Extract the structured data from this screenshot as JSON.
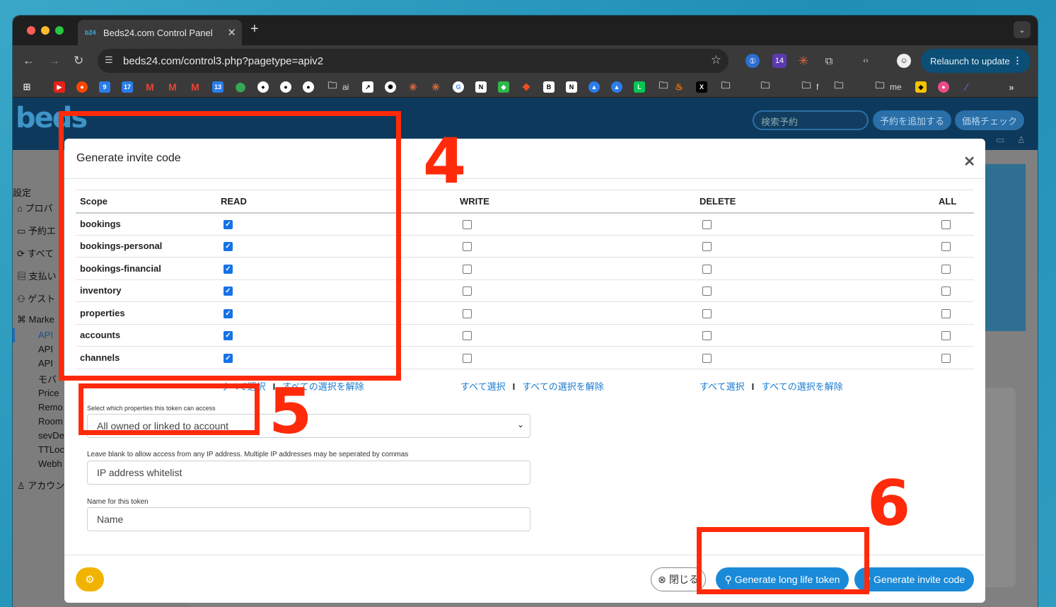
{
  "browser": {
    "tab_title": "Beds24.com Control Panel",
    "tab_favicon": "b24",
    "address": "beds24.com/control3.php?pagetype=apiv2",
    "relaunch_label": "Relaunch to update",
    "extension_badge": "14",
    "bookmark_texts": [
      "ai",
      "f",
      "me"
    ]
  },
  "app": {
    "logo_text": "beds",
    "search_placeholder": "検索予約",
    "header_buttons": [
      "予約を追加する",
      "価格チェック"
    ],
    "sidebar": {
      "section": "設定",
      "items": [
        "プロパ",
        "予約エ",
        "すべて",
        "支払い",
        "ゲスト",
        "Marke"
      ],
      "subitems": [
        "API",
        "API",
        "API",
        "モバ",
        "Price",
        "Remo",
        "Room",
        "sevDe",
        "TTLoc",
        "Webh"
      ],
      "account": "アカウン"
    }
  },
  "modal": {
    "title": "Generate invite code",
    "columns": [
      "Scope",
      "READ",
      "WRITE",
      "DELETE",
      "ALL"
    ],
    "rows": [
      {
        "scope": "bookings",
        "read": true,
        "write": false,
        "delete": false,
        "all": false
      },
      {
        "scope": "bookings-personal",
        "read": true,
        "write": false,
        "delete": false,
        "all": false
      },
      {
        "scope": "bookings-financial",
        "read": true,
        "write": false,
        "delete": false,
        "all": false
      },
      {
        "scope": "inventory",
        "read": true,
        "write": false,
        "delete": false,
        "all": false
      },
      {
        "scope": "properties",
        "read": true,
        "write": false,
        "delete": false,
        "all": false
      },
      {
        "scope": "accounts",
        "read": true,
        "write": false,
        "delete": false,
        "all": false
      },
      {
        "scope": "channels",
        "read": true,
        "write": false,
        "delete": false,
        "all": false
      }
    ],
    "select_all": "すべて選択",
    "deselect_all": "すべての選択を解除",
    "properties_label": "Select which properties this token can access",
    "properties_value": "All owned or linked to account",
    "ip_help": "Leave blank to allow access from any IP address. Multiple IP addresses may be seperated by commas",
    "ip_placeholder": "IP address whitelist",
    "name_label": "Name for this token",
    "name_placeholder": "Name",
    "close_label": "閉じる",
    "long_life_label": "Generate long life token",
    "invite_label": "Generate invite code"
  },
  "annotations": {
    "step4": "4",
    "step5": "5",
    "step6": "6",
    "highlight_color": "#ff2a0a"
  }
}
